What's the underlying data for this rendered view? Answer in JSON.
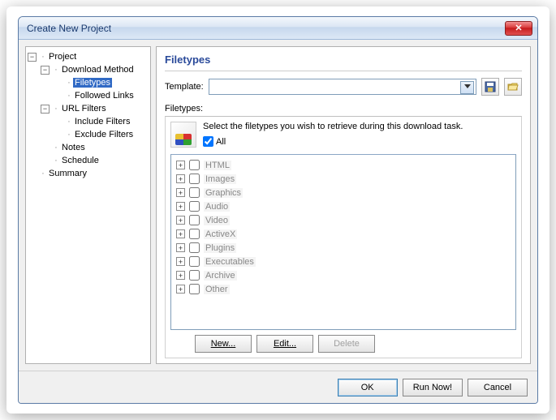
{
  "window": {
    "title": "Create New Project"
  },
  "tree": [
    {
      "label": "Project",
      "depth": 0,
      "expand": true
    },
    {
      "label": "Download Method",
      "depth": 1,
      "expand": true
    },
    {
      "label": "Filetypes",
      "depth": 2,
      "selected": true
    },
    {
      "label": "Followed Links",
      "depth": 2
    },
    {
      "label": "URL Filters",
      "depth": 1,
      "expand": true
    },
    {
      "label": "Include Filters",
      "depth": 2
    },
    {
      "label": "Exclude Filters",
      "depth": 2
    },
    {
      "label": "Notes",
      "depth": 1
    },
    {
      "label": "Schedule",
      "depth": 1
    },
    {
      "label": "Summary",
      "depth": 0
    }
  ],
  "main": {
    "heading": "Filetypes",
    "template_label": "Template:",
    "filetypes_label": "Filetypes:",
    "description": "Select the filetypes you wish to retrieve during this download task.",
    "all_label": "All",
    "all_checked": true,
    "items": [
      "HTML",
      "Images",
      "Graphics",
      "Audio",
      "Video",
      "ActiveX",
      "Plugins",
      "Executables",
      "Archive",
      "Other"
    ],
    "buttons": {
      "new": "New...",
      "edit": "Edit...",
      "delete": "Delete"
    }
  },
  "footer": {
    "ok": "OK",
    "run": "Run Now!",
    "cancel": "Cancel"
  }
}
